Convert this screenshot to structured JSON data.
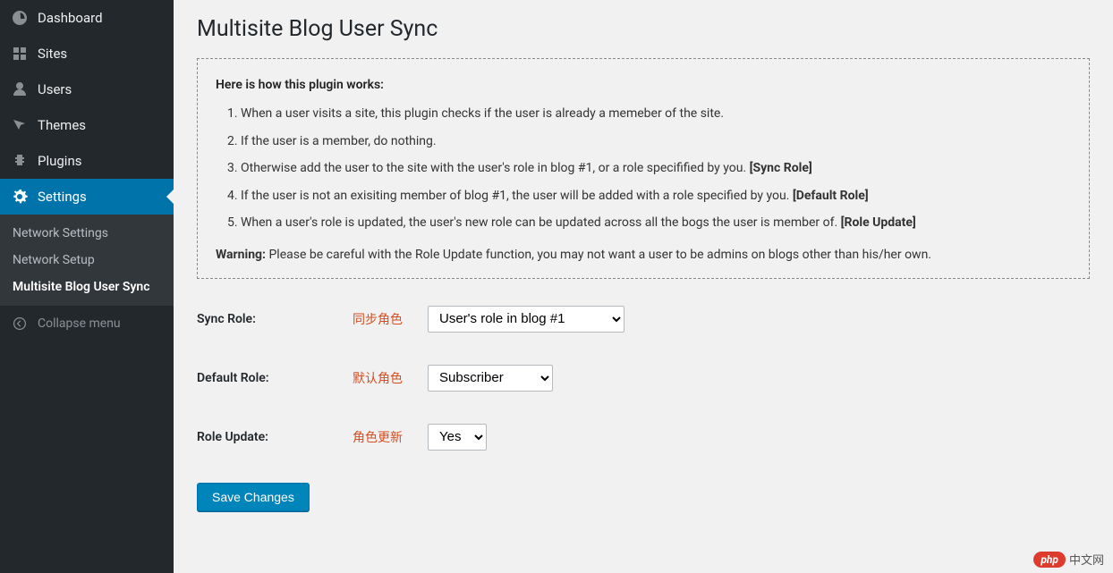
{
  "sidebar": {
    "items": [
      {
        "label": "Dashboard"
      },
      {
        "label": "Sites"
      },
      {
        "label": "Users"
      },
      {
        "label": "Themes"
      },
      {
        "label": "Plugins"
      },
      {
        "label": "Settings"
      }
    ],
    "submenu": [
      {
        "label": "Network Settings"
      },
      {
        "label": "Network Setup"
      },
      {
        "label": "Multisite Blog User Sync"
      }
    ],
    "collapse_label": "Collapse menu"
  },
  "page": {
    "title": "Multisite Blog User Sync"
  },
  "notice": {
    "heading": "Here is how this plugin works:",
    "steps": [
      {
        "text": "When a user visits a site, this plugin checks if the user is already a memeber of the site."
      },
      {
        "text": "If the user is a member, do nothing."
      },
      {
        "text": "Otherwise add the user to the site with the user's role in blog #1, or a role specifified by you. ",
        "bold": "[Sync Role]"
      },
      {
        "text": "If the user is not an exisiting member of blog #1, the user will be added with a role specified by you. ",
        "bold": "[Default Role]"
      },
      {
        "text": "When a user's role is updated, the user's new role can be updated across all the bogs the user is member of. ",
        "bold": "[Role Update]"
      }
    ],
    "warning_label": "Warning:",
    "warning_text": " Please be careful with the Role Update function, you may not want a user to be admins on blogs other than his/her own."
  },
  "form": {
    "sync_role": {
      "label": "Sync Role:",
      "annotation": "同步角色",
      "value": "User's role in blog #1"
    },
    "default_role": {
      "label": "Default Role:",
      "annotation": "默认角色",
      "value": "Subscriber"
    },
    "role_update": {
      "label": "Role Update:",
      "annotation": "角色更新",
      "value": "Yes"
    },
    "submit_label": "Save Changes"
  },
  "watermark": {
    "pill": "php",
    "text": "中文网"
  }
}
